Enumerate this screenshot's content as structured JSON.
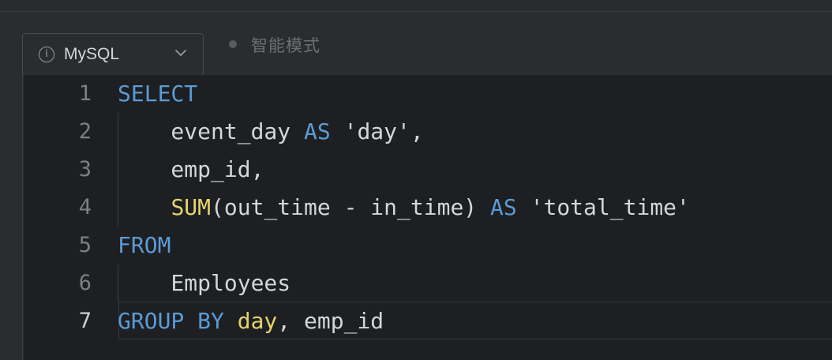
{
  "toolbar": {
    "language": "MySQL",
    "mode_label": "智能模式"
  },
  "icons": {
    "info": "info-icon",
    "chevron": "chevron-down-icon",
    "mode_dot": "status-dot"
  },
  "colors": {
    "keyword": "#5b9bd5",
    "function": "#e5d36e",
    "text": "#d5d6d9",
    "editor_bg": "#1d1f22"
  },
  "editor": {
    "active_line": 7,
    "lines": [
      {
        "num": "1",
        "tokens": [
          {
            "t": "SELECT",
            "c": "kw"
          }
        ]
      },
      {
        "num": "2",
        "tokens": [
          {
            "t": "    event_day ",
            "c": "plain"
          },
          {
            "t": "AS",
            "c": "kw"
          },
          {
            "t": " 'day',",
            "c": "str"
          }
        ]
      },
      {
        "num": "3",
        "tokens": [
          {
            "t": "    emp_id,",
            "c": "plain"
          }
        ]
      },
      {
        "num": "4",
        "tokens": [
          {
            "t": "    ",
            "c": "plain"
          },
          {
            "t": "SUM",
            "c": "fn"
          },
          {
            "t": "(out_time - in_time) ",
            "c": "plain"
          },
          {
            "t": "AS",
            "c": "kw"
          },
          {
            "t": " 'total_time'",
            "c": "str"
          }
        ]
      },
      {
        "num": "5",
        "tokens": [
          {
            "t": "FROM",
            "c": "kw"
          }
        ]
      },
      {
        "num": "6",
        "tokens": [
          {
            "t": "    Employees",
            "c": "plain"
          }
        ]
      },
      {
        "num": "7",
        "tokens": [
          {
            "t": "GROUP BY",
            "c": "kw"
          },
          {
            "t": " ",
            "c": "plain"
          },
          {
            "t": "day",
            "c": "id"
          },
          {
            "t": ", emp_id",
            "c": "plain"
          }
        ]
      }
    ]
  }
}
